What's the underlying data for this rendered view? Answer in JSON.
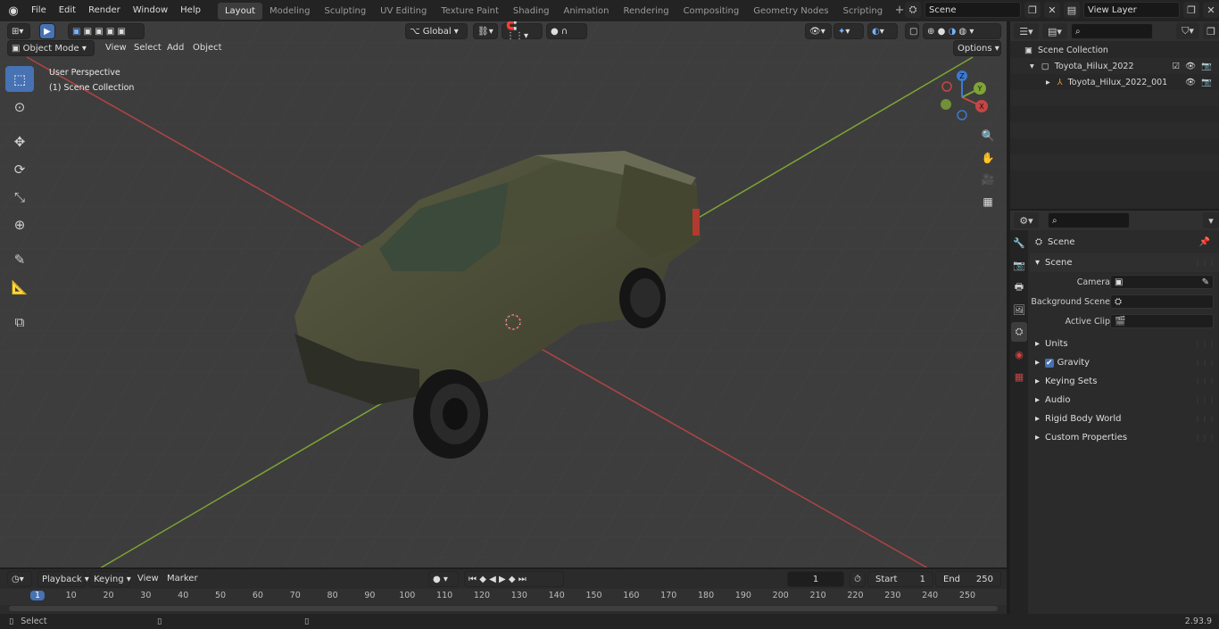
{
  "menu": [
    "File",
    "Edit",
    "Render",
    "Window",
    "Help"
  ],
  "workspaces": [
    "Layout",
    "Modeling",
    "Sculpting",
    "UV Editing",
    "Texture Paint",
    "Shading",
    "Animation",
    "Rendering",
    "Compositing",
    "Geometry Nodes",
    "Scripting"
  ],
  "active_workspace": "Layout",
  "scene_field": "Scene",
  "view_layer_field": "View Layer",
  "viewport": {
    "mode": "Object Mode",
    "menus": [
      "View",
      "Select",
      "Add",
      "Object"
    ],
    "transform_orientation": "Global",
    "options": "Options",
    "perspective_label": "User Perspective",
    "collection_label": "(1) Scene Collection",
    "gizmo": {
      "x": "X",
      "y": "Y",
      "z": "Z"
    }
  },
  "outliner": {
    "root": "Scene Collection",
    "items": [
      "Toyota_Hilux_2022",
      "Toyota_Hilux_2022_001"
    ]
  },
  "properties": {
    "header": "Scene",
    "panel": "Scene",
    "fields": [
      {
        "label": "Camera",
        "value": ""
      },
      {
        "label": "Background Scene",
        "value": ""
      },
      {
        "label": "Active Clip",
        "value": ""
      }
    ],
    "subpanels": [
      "Units",
      "Gravity",
      "Keying Sets",
      "Audio",
      "Rigid Body World",
      "Custom Properties"
    ]
  },
  "timeline": {
    "menus": [
      "Playback",
      "Keying",
      "View",
      "Marker"
    ],
    "current_frame": "1",
    "start_label": "Start",
    "start": "1",
    "end_label": "End",
    "end": "250",
    "ticks": [
      "1",
      "10",
      "20",
      "30",
      "40",
      "50",
      "60",
      "70",
      "80",
      "90",
      "100",
      "110",
      "120",
      "130",
      "140",
      "150",
      "160",
      "170",
      "180",
      "190",
      "200",
      "210",
      "220",
      "230",
      "240",
      "250"
    ]
  },
  "status": {
    "left": "Select",
    "version": "2.93.9"
  },
  "colors": {
    "accent": "#4772b3",
    "x_axis": "#c84545",
    "y_axis": "#7fa534",
    "z_axis": "#3b7ad2"
  }
}
